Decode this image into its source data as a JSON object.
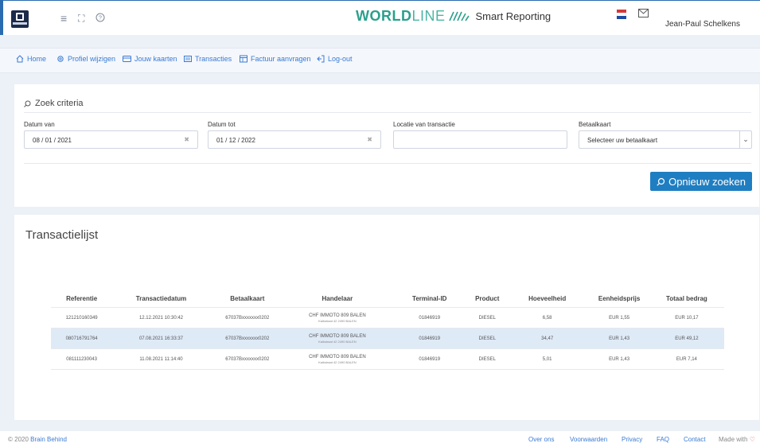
{
  "header": {
    "brand_bold": "WORLD",
    "brand_thin": "LINE",
    "brand_product": "Smart Reporting",
    "user_name": "Jean-Paul Schelkens",
    "colors": {
      "brand": "#2aa08c",
      "accent": "#1f7ec2"
    }
  },
  "nav": {
    "items": [
      {
        "label": "Home",
        "icon": "home-icon"
      },
      {
        "label": "Profiel wijzigen",
        "icon": "gear-icon"
      },
      {
        "label": "Jouw kaarten",
        "icon": "card-icon"
      },
      {
        "label": "Transacties",
        "icon": "list-icon"
      },
      {
        "label": "Factuur aanvragen",
        "icon": "invoice-icon"
      },
      {
        "label": "Log-out",
        "icon": "logout-icon"
      }
    ]
  },
  "search": {
    "title": "Zoek criteria",
    "date_from_label": "Datum van",
    "date_from_value": "08 / 01 / 2021",
    "date_to_label": "Datum tot",
    "date_to_value": "01 / 12 / 2022",
    "location_label": "Locatie van transactie",
    "location_value": "",
    "card_label": "Betaalkaart",
    "card_value": "Selecteer uw betaalkaart",
    "button_label": "Opnieuw zoeken"
  },
  "list": {
    "title": "Transactielijst",
    "columns": [
      "Referentie",
      "Transactiedatum",
      "Betaalkaart",
      "Handelaar",
      "Terminal-ID",
      "Product",
      "Hoeveelheid",
      "Eenheidsprijs",
      "Totaal bedrag"
    ],
    "rows": [
      {
        "ref": "121210160349",
        "date": "12.12.2021 10:30:42",
        "card": "67037Bxxxxxxx0202",
        "merchant": "CHF IMMOTO 809 BALEN",
        "merchant_addr": "Kalkstraat 42 2490 BALEN",
        "terminal": "01846919",
        "product": "DIESEL",
        "qty": "6,58",
        "unit": "EUR 1,55",
        "total": "EUR 10,17"
      },
      {
        "ref": "080716791764",
        "date": "07.08.2021 16:33:37",
        "card": "67037Bxxxxxxx0202",
        "merchant": "CHF IMMOTO 809 BALEN",
        "merchant_addr": "Kalkstraat 42 2490 BALEN",
        "terminal": "01846919",
        "product": "DIESEL",
        "qty": "34,47",
        "unit": "EUR 1,43",
        "total": "EUR 49,12"
      },
      {
        "ref": "081111230043",
        "date": "11.08.2021 11:14:40",
        "card": "67037Bxxxxxxx0202",
        "merchant": "CHF IMMOTO 809 BALEN",
        "merchant_addr": "Kalkstraat 42 2490 BALEN",
        "terminal": "01846919",
        "product": "DIESEL",
        "qty": "5,01",
        "unit": "EUR 1,43",
        "total": "EUR 7,14"
      }
    ]
  },
  "footer": {
    "copyright": "© 2020",
    "company": "Brain Behind",
    "links": [
      "Over ons",
      "Voorwaarden",
      "Privacy",
      "FAQ",
      "Contact"
    ],
    "made_with": "Made with"
  }
}
